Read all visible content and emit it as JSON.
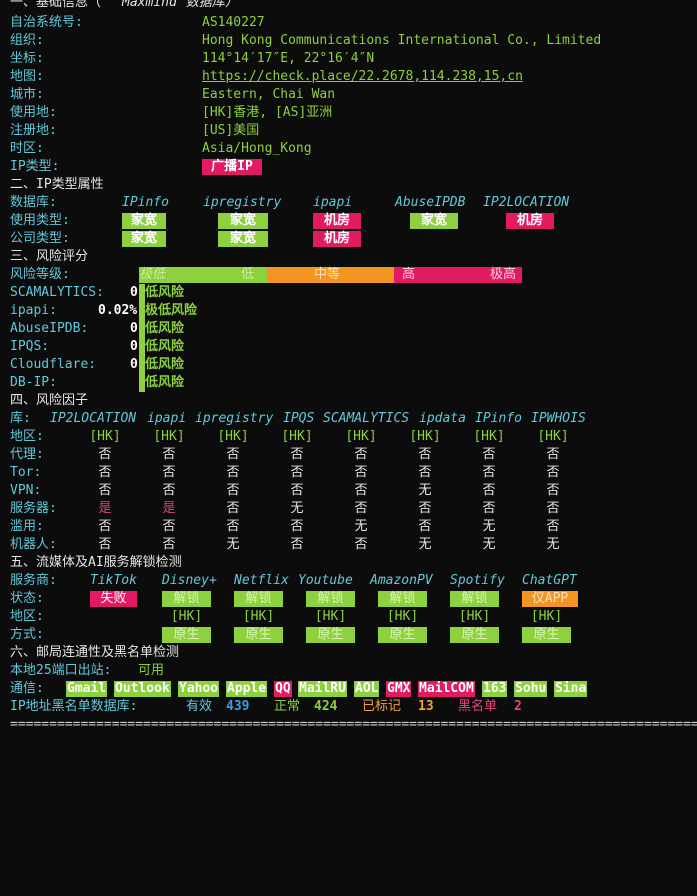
{
  "basic": {
    "title_prefix": "一、基础信息（",
    "title_source": "Maxmind",
    "title_suffix": " 数据库）",
    "rows": [
      {
        "label": "自治系统号:",
        "value": "AS140227"
      },
      {
        "label": "组织:",
        "value": "Hong Kong Communications International Co., Limited"
      },
      {
        "label": "坐标:",
        "value": "114°14′17″E, 22°16′4″N"
      },
      {
        "label": "地图:",
        "value": "https://check.place/22.2678,114.238,15,cn"
      },
      {
        "label": "城市:",
        "value": "Eastern, Chai Wan"
      },
      {
        "label": "使用地:",
        "value": "[HK]香港, [AS]亚洲"
      },
      {
        "label": "注册地:",
        "value": "[US]美国"
      },
      {
        "label": "时区:",
        "value": "Asia/Hong_Kong"
      }
    ],
    "iptype_label": "IP类型:",
    "iptype_value": "广播IP"
  },
  "ip_type": {
    "title": "二、IP类型属性",
    "db_label": "数据库:",
    "databases": [
      "IPinfo",
      "ipregistry",
      "ipapi",
      "AbuseIPDB",
      "IP2LOCATION"
    ],
    "usage_label": "使用类型:",
    "usage": [
      "家宽",
      "家宽",
      "机房",
      "家宽",
      "机房"
    ],
    "company_label": "公司类型:",
    "company": [
      "家宽",
      "家宽",
      "机房"
    ]
  },
  "risk": {
    "title": "三、风险评分",
    "level_label": "风险等级:",
    "scale": [
      "极低",
      "低",
      "中等",
      "高",
      "极高"
    ],
    "rows": [
      {
        "label": "SCAMALYTICS:",
        "score": "0",
        "level": "低风险"
      },
      {
        "label": "ipapi:",
        "score": "0.02%",
        "level": "极低风险"
      },
      {
        "label": "AbuseIPDB:",
        "score": "0",
        "level": "低风险"
      },
      {
        "label": "IPQS:",
        "score": "0",
        "level": "低风险"
      },
      {
        "label": "Cloudflare:",
        "score": "0",
        "level": "低风险"
      },
      {
        "label": "DB-IP:",
        "score": "",
        "level": "低风险"
      }
    ]
  },
  "factors": {
    "title": "四、风险因子",
    "lib_label": "库:",
    "libs": [
      "IP2LOCATION",
      "ipapi",
      "ipregistry",
      "IPQS",
      "SCAMALYTICS",
      "ipdata",
      "IPinfo",
      "IPWHOIS"
    ],
    "rows": [
      {
        "label": "地区:",
        "values": [
          "[HK]",
          "[HK]",
          "[HK]",
          "[HK]",
          "[HK]",
          "[HK]",
          "[HK]",
          "[HK]"
        ]
      },
      {
        "label": "代理:",
        "values": [
          "否",
          "否",
          "否",
          "否",
          "否",
          "否",
          "否",
          "否"
        ]
      },
      {
        "label": "Tor:",
        "values": [
          "否",
          "否",
          "否",
          "否",
          "否",
          "否",
          "否",
          "否"
        ]
      },
      {
        "label": "VPN:",
        "values": [
          "否",
          "否",
          "否",
          "否",
          "否",
          "无",
          "否",
          "否"
        ]
      },
      {
        "label": "服务器:",
        "values": [
          "是",
          "是",
          "否",
          "无",
          "否",
          "否",
          "否",
          "否"
        ]
      },
      {
        "label": "滥用:",
        "values": [
          "否",
          "否",
          "否",
          "否",
          "无",
          "否",
          "无",
          "否"
        ]
      },
      {
        "label": "机器人:",
        "values": [
          "否",
          "否",
          "无",
          "否",
          "否",
          "无",
          "无",
          "无"
        ]
      }
    ]
  },
  "streaming": {
    "title": "五、流媒体及AI服务解锁检测",
    "provider_label": "服务商:",
    "providers": [
      "TikTok",
      "Disney+",
      "Netflix",
      "Youtube",
      "AmazonPV",
      "Spotify",
      "ChatGPT"
    ],
    "status_label": "状态:",
    "status": [
      "失败",
      "解锁",
      "解锁",
      "解锁",
      "解锁",
      "解锁",
      "仅APP"
    ],
    "region_label": "地区:",
    "regions": [
      "",
      "[HK]",
      "[HK]",
      "[HK]",
      "[HK]",
      "[HK]",
      "[HK]"
    ],
    "method_label": "方式:",
    "methods": [
      "",
      "原生",
      "原生",
      "原生",
      "原生",
      "原生",
      "原生"
    ]
  },
  "mail": {
    "title": "六、邮局连通性及黑名单检测",
    "port25_label": "本地25端口出站:",
    "port25_value": "可用",
    "conn_label": "通信:",
    "providers": [
      "Gmail",
      "Outlook",
      "Yahoo",
      "Apple",
      "QQ",
      "MailRU",
      "AOL",
      "GMX",
      "MailCOM",
      "163",
      "Sohu",
      "Sina"
    ],
    "provider_colors": [
      "#8ed13f",
      "#8ed13f",
      "#8ed13f",
      "#8ed13f",
      "#e01b64",
      "#8ed13f",
      "#8ed13f",
      "#e01b64",
      "#e01b64",
      "#8ed13f",
      "#8ed13f",
      "#8ed13f"
    ],
    "blacklist_label": "IP地址黑名单数据库:",
    "valid_label": "有效",
    "valid_count": "439",
    "normal_label": "正常",
    "normal_count": "424",
    "marked_label": "已标记",
    "marked_count": "13",
    "black_label": "黑名单",
    "black_count": "2"
  },
  "separator": "====================================================================================================="
}
